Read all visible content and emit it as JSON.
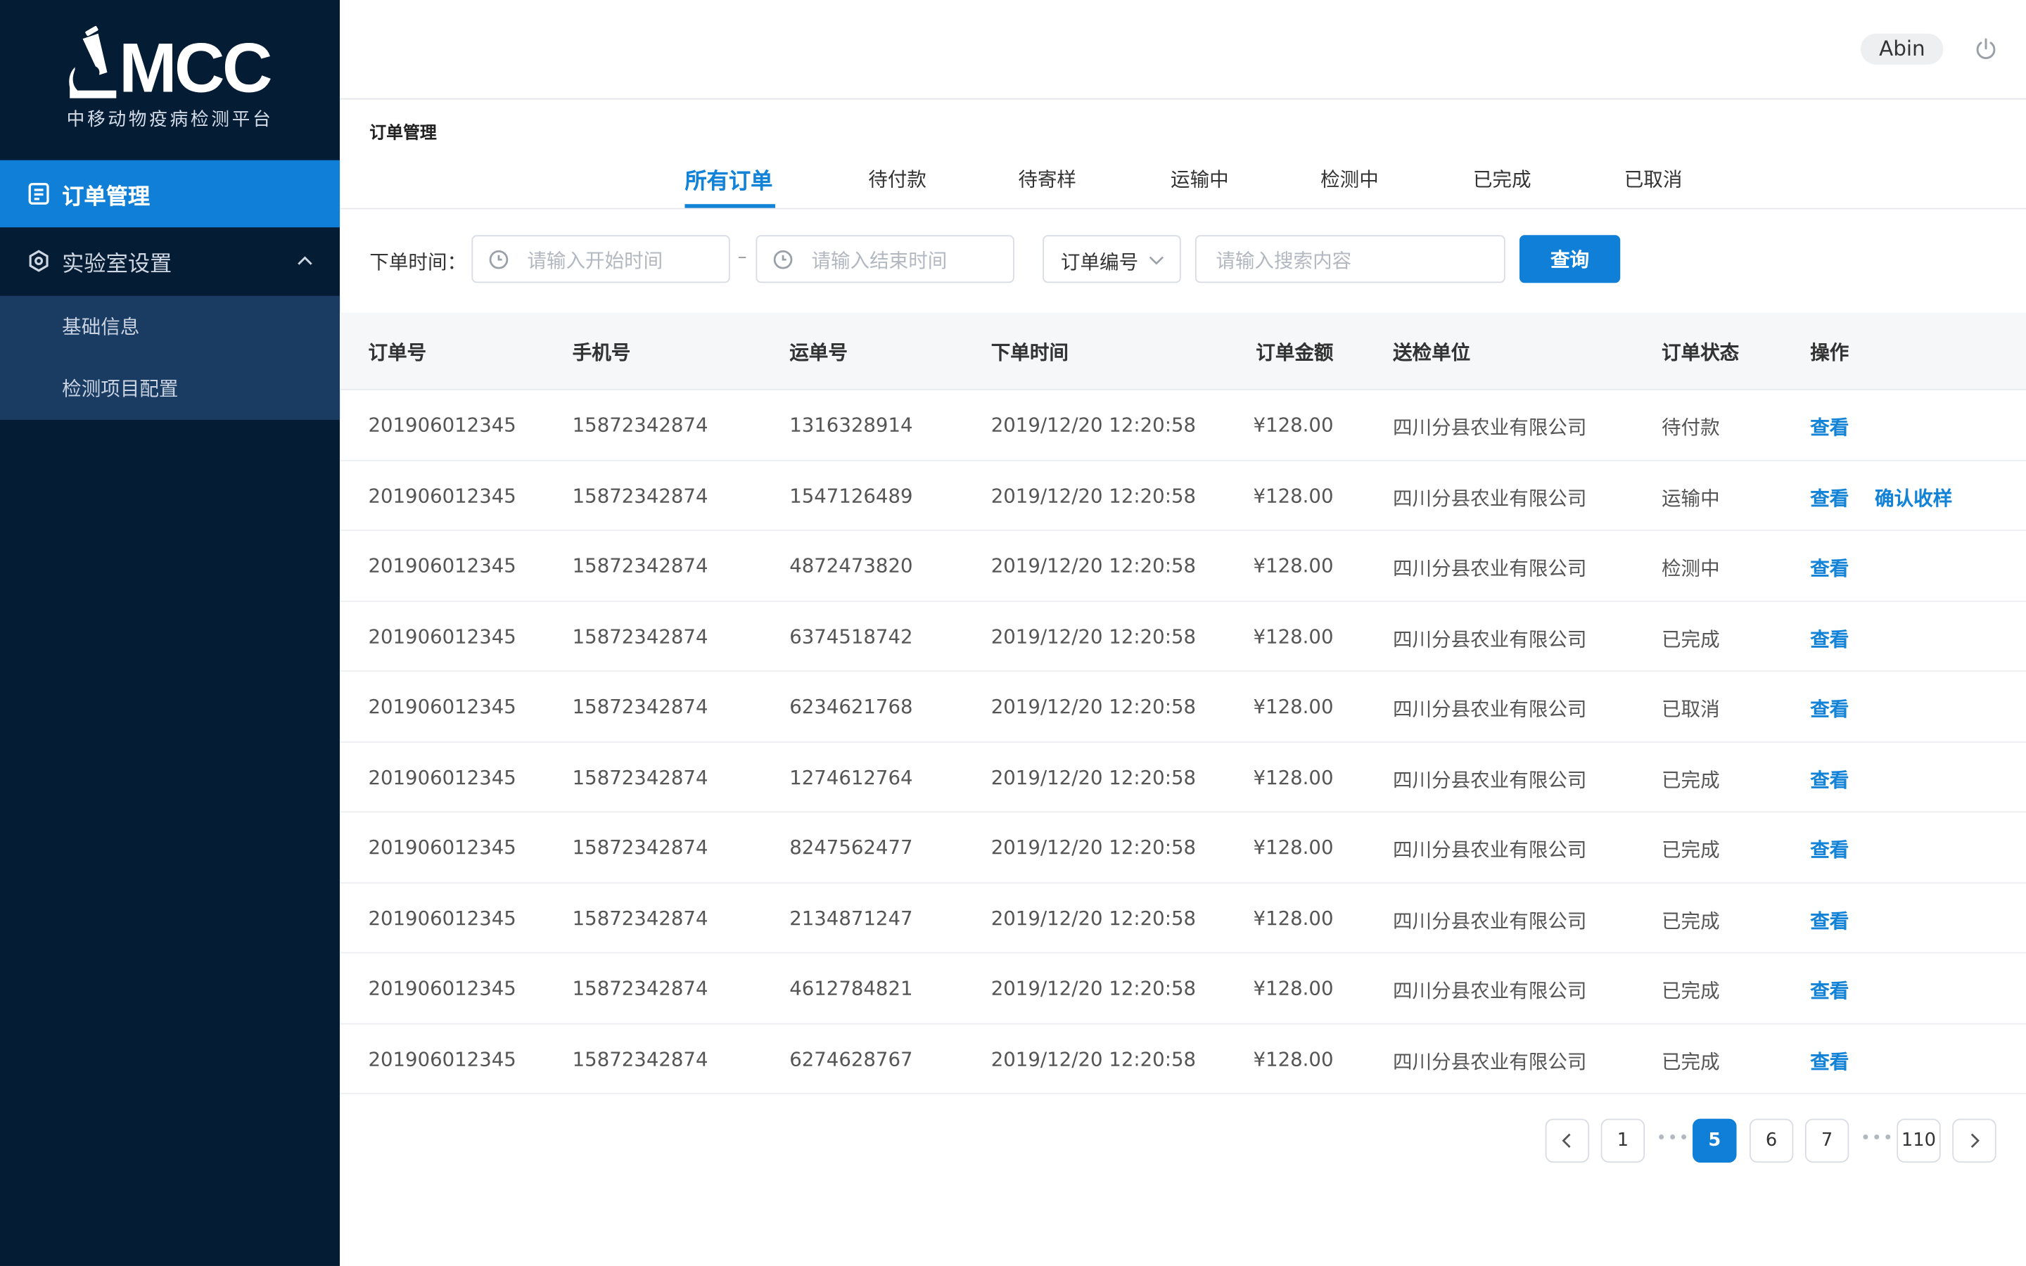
{
  "brand": {
    "logo_text": "MCC",
    "subtitle": "中移动物疫病检测平台"
  },
  "sidebar": {
    "items": [
      {
        "label": "订单管理",
        "icon": "document-icon",
        "active": true
      },
      {
        "label": "实验室设置",
        "icon": "settings-icon",
        "expanded": true
      }
    ],
    "sub_items": [
      {
        "label": "基础信息"
      },
      {
        "label": "检测项目配置"
      }
    ]
  },
  "header": {
    "user": "Abin"
  },
  "breadcrumb": "订单管理",
  "tabs": [
    "所有订单",
    "待付款",
    "待寄样",
    "运输中",
    "检测中",
    "已完成",
    "已取消"
  ],
  "filters": {
    "time_label": "下单时间：",
    "start_placeholder": "请输入开始时间",
    "end_placeholder": "请输入结束时间",
    "dash": "–",
    "select_value": "订单编号",
    "search_placeholder": "请输入搜索内容",
    "query_button": "查询"
  },
  "table": {
    "headers": [
      "订单号",
      "手机号",
      "运单号",
      "下单时间",
      "订单金额",
      "送检单位",
      "订单状态",
      "操作"
    ],
    "rows": [
      {
        "order": "201906012345",
        "phone": "15872342874",
        "waybill": "1316328914",
        "time": "2019/12/20 12:20:58",
        "amount": "¥128.00",
        "unit": "四川分县农业有限公司",
        "status": "待付款",
        "actions": [
          "查看"
        ]
      },
      {
        "order": "201906012345",
        "phone": "15872342874",
        "waybill": "1547126489",
        "time": "2019/12/20 12:20:58",
        "amount": "¥128.00",
        "unit": "四川分县农业有限公司",
        "status": "运输中",
        "actions": [
          "查看",
          "确认收样"
        ]
      },
      {
        "order": "201906012345",
        "phone": "15872342874",
        "waybill": "4872473820",
        "time": "2019/12/20 12:20:58",
        "amount": "¥128.00",
        "unit": "四川分县农业有限公司",
        "status": "检测中",
        "actions": [
          "查看"
        ]
      },
      {
        "order": "201906012345",
        "phone": "15872342874",
        "waybill": "6374518742",
        "time": "2019/12/20 12:20:58",
        "amount": "¥128.00",
        "unit": "四川分县农业有限公司",
        "status": "已完成",
        "actions": [
          "查看"
        ]
      },
      {
        "order": "201906012345",
        "phone": "15872342874",
        "waybill": "6234621768",
        "time": "2019/12/20 12:20:58",
        "amount": "¥128.00",
        "unit": "四川分县农业有限公司",
        "status": "已取消",
        "actions": [
          "查看"
        ]
      },
      {
        "order": "201906012345",
        "phone": "15872342874",
        "waybill": "1274612764",
        "time": "2019/12/20 12:20:58",
        "amount": "¥128.00",
        "unit": "四川分县农业有限公司",
        "status": "已完成",
        "actions": [
          "查看"
        ]
      },
      {
        "order": "201906012345",
        "phone": "15872342874",
        "waybill": "8247562477",
        "time": "2019/12/20 12:20:58",
        "amount": "¥128.00",
        "unit": "四川分县农业有限公司",
        "status": "已完成",
        "actions": [
          "查看"
        ]
      },
      {
        "order": "201906012345",
        "phone": "15872342874",
        "waybill": "2134871247",
        "time": "2019/12/20 12:20:58",
        "amount": "¥128.00",
        "unit": "四川分县农业有限公司",
        "status": "已完成",
        "actions": [
          "查看"
        ]
      },
      {
        "order": "201906012345",
        "phone": "15872342874",
        "waybill": "4612784821",
        "time": "2019/12/20 12:20:58",
        "amount": "¥128.00",
        "unit": "四川分县农业有限公司",
        "status": "已完成",
        "actions": [
          "查看"
        ]
      },
      {
        "order": "201906012345",
        "phone": "15872342874",
        "waybill": "6274628767",
        "time": "2019/12/20 12:20:58",
        "amount": "¥128.00",
        "unit": "四川分县农业有限公司",
        "status": "已完成",
        "actions": [
          "查看"
        ]
      }
    ]
  },
  "pagination": {
    "pages": [
      "1",
      "5",
      "6",
      "7",
      "110"
    ],
    "current": "5",
    "ellipsis": "•••"
  },
  "colors": {
    "sidebar_bg": "#041c34",
    "accent": "#0f7fd7",
    "submenu_bg": "#1a3b62",
    "link": "#1383d7"
  }
}
